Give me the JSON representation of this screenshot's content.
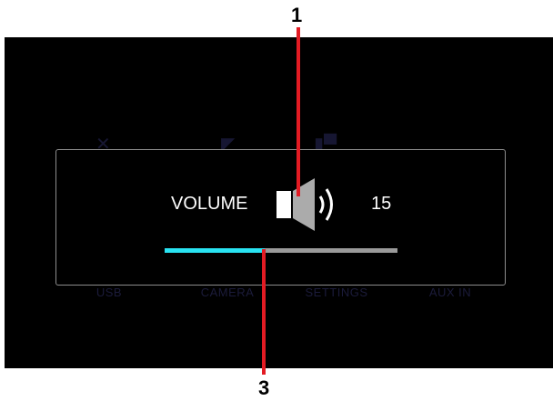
{
  "volume_overlay": {
    "label": "VOLUME",
    "value": "15",
    "level_fraction": 0.43,
    "fill_color": "#29e3f2",
    "track_color": "#9a9a9a",
    "icon": "speaker-icon"
  },
  "background_menu": {
    "items": [
      {
        "label": "USB"
      },
      {
        "label": "CAMERA"
      },
      {
        "label": "SETTINGS"
      },
      {
        "label": "AUX IN"
      }
    ]
  },
  "callouts": [
    {
      "number": "1",
      "target": "speaker-icon"
    },
    {
      "number": "3",
      "target": "volume-slider"
    }
  ],
  "colors": {
    "callout_line": "#e31b23",
    "panel_border": "#8d8d8d",
    "screen_background": "#000000"
  }
}
